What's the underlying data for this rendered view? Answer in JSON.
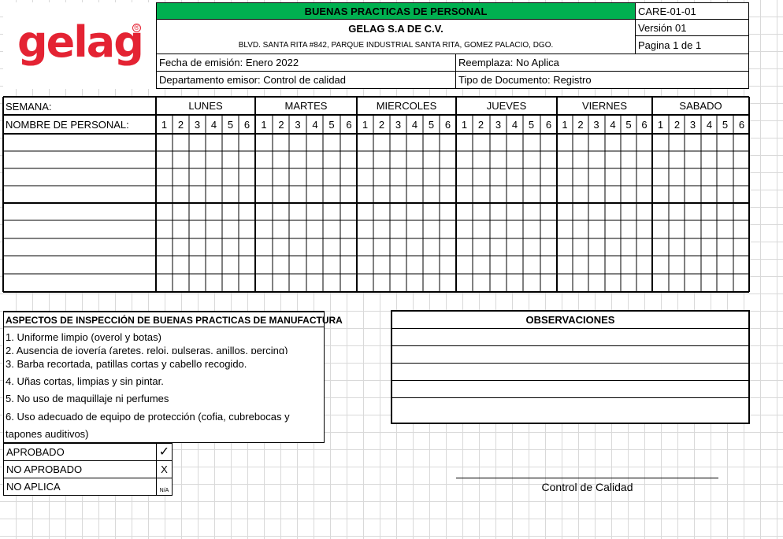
{
  "header": {
    "title": "BUENAS PRACTICAS DE PERSONAL",
    "company": "GELAG S.A DE C.V.",
    "address": "BLVD. SANTA RITA #842, PARQUE INDUSTRIAL SANTA RITA, GOMEZ PALACIO, DGO.",
    "code": "CARE-01-01",
    "version": "Versión 01",
    "page": "Pagina 1 de 1",
    "issue_date": "Fecha de emisión: Enero 2022",
    "replaces": "Reemplaza: No Aplica",
    "department": "Departamento emisor: Control de calidad",
    "doc_type": "Tipo de Documento: Registro",
    "title_bg": "#00b050"
  },
  "logo": {
    "text": "gelag",
    "mark": "®",
    "color": "#e42333"
  },
  "schedule": {
    "week_label": "SEMANA:",
    "name_label": "NOMBRE DE PERSONAL:",
    "days": [
      "LUNES",
      "MARTES",
      "MIERCOLES",
      "JUEVES",
      "VIERNES",
      "SABADO"
    ],
    "slots": [
      "1",
      "2",
      "3",
      "4",
      "5",
      "6"
    ]
  },
  "inspection": {
    "title": "ASPECTOS DE INSPECCIÓN DE BUENAS PRACTICAS DE MANUFACTURA",
    "items": [
      "1. Uniforme limpio (overol y botas)",
      "2. Ausencia de joyería (aretes, reloj, pulseras, anillos, percing)",
      "3. Barba recortada, patillas cortas y cabello recogido.",
      "4. Uñas cortas, limpias y sin pintar.",
      "5. No uso de maquillaje ni perfumes",
      "6. Uso adecuado de equipo de protección (cofia, cubrebocas y",
      "tapones auditivos)"
    ]
  },
  "legend": [
    {
      "label": "APROBADO",
      "symbol": "✓"
    },
    {
      "label": "NO APROBADO",
      "symbol": "X"
    },
    {
      "label": "NO APLICA",
      "symbol": "N/A"
    }
  ],
  "observations": {
    "title": "OBSERVACIONES"
  },
  "signature": {
    "label": "Control de Calidad"
  }
}
